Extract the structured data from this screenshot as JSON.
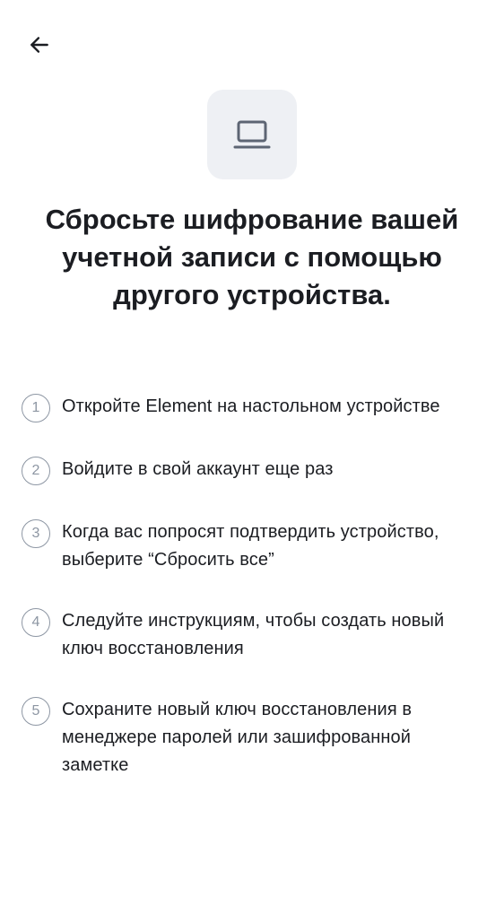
{
  "header": {
    "back_icon": "arrow-left-icon"
  },
  "hero": {
    "icon": "laptop-icon",
    "title": "Сбросьте шифрование вашей учетной записи с помощью другого устройства."
  },
  "steps": [
    {
      "number": "1",
      "text": "Откройте Element на настольном устройстве"
    },
    {
      "number": "2",
      "text": "Войдите в свой аккаунт еще раз"
    },
    {
      "number": "3",
      "text": "Когда вас попросят подтвердить устройство, выберите “Сбросить все”"
    },
    {
      "number": "4",
      "text": "Следуйте инструкциям, чтобы создать новый ключ восстановления"
    },
    {
      "number": "5",
      "text": "Сохраните новый  ключ восстановления в менеджере паролей или зашифрованной заметке"
    }
  ],
  "colors": {
    "text": "#1b1d22",
    "muted": "#8d96a3",
    "tile_bg": "#eef0f4"
  }
}
